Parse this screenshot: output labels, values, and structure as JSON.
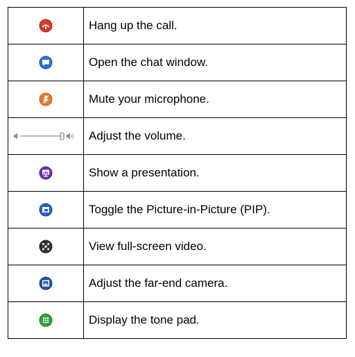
{
  "legend": {
    "rows": [
      {
        "icon": "hang-up-icon",
        "description": "Hang up the call.",
        "color": "#d23a2a"
      },
      {
        "icon": "chat-icon",
        "description": "Open the chat window.",
        "color": "#2b6fd6"
      },
      {
        "icon": "microphone-mute-icon",
        "description": "Mute your microphone.",
        "color": "#e8782a"
      },
      {
        "icon": "volume-slider-icon",
        "description": "Adjust the volume.",
        "color": "#9a9a9a"
      },
      {
        "icon": "presentation-icon",
        "description": "Show a presentation.",
        "color": "#6a2fb3"
      },
      {
        "icon": "pip-icon",
        "description": "Toggle the Picture-in-Picture (PIP).",
        "color": "#1f63c8"
      },
      {
        "icon": "full-screen-icon",
        "description": "View full-screen video.",
        "color": "#333333"
      },
      {
        "icon": "far-end-camera-icon",
        "description": "Adjust the far-end camera.",
        "color": "#2456a6"
      },
      {
        "icon": "tone-pad-icon",
        "description": "Display the tone pad.",
        "color": "#34a03a"
      }
    ]
  }
}
